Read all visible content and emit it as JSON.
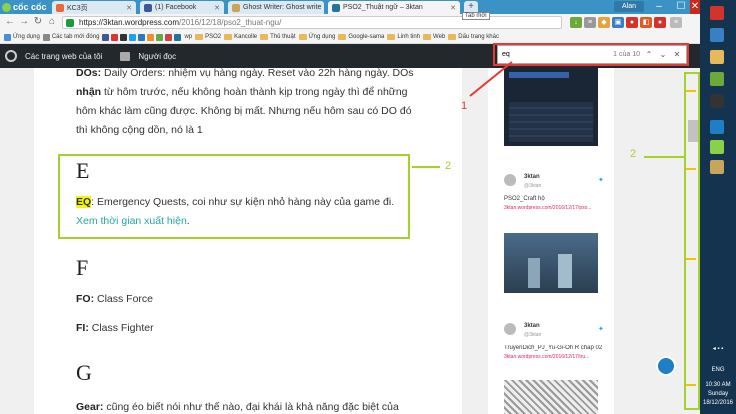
{
  "browser": {
    "logo": "cốc cốc",
    "tabs": [
      {
        "label": "KC3页"
      },
      {
        "label": "(1) Facebook"
      },
      {
        "label": "Ghost Writer: Ghost write"
      },
      {
        "label": "PSO2_Thuật ngữ – 3ktan"
      }
    ],
    "new_tab_tooltip": "Tab mới",
    "user": "Alan",
    "url_host": "https://3ktan.wordpress.com",
    "url_path": "/2016/12/18/pso2_thuat-ngu/"
  },
  "bookmarks": [
    {
      "label": "Ứng dụng",
      "type": "apps"
    },
    {
      "label": "Các tab mới đóng",
      "type": "item"
    },
    {
      "label": "wp",
      "type": "item"
    },
    {
      "label": "PSO2",
      "type": "folder"
    },
    {
      "label": "Kancolle",
      "type": "folder"
    },
    {
      "label": "Thủ thuật",
      "type": "folder"
    },
    {
      "label": "Ứng dụng",
      "type": "folder"
    },
    {
      "label": "Google-sama",
      "type": "folder"
    },
    {
      "label": "Linh tinh",
      "type": "folder"
    },
    {
      "label": "Web",
      "type": "folder"
    },
    {
      "label": "Dấu trang khác",
      "type": "folder"
    }
  ],
  "wpbar": {
    "sites": "Các trang web của tôi",
    "reader": "Người đọc"
  },
  "find": {
    "query": "eq",
    "count": "1 của 10"
  },
  "article": {
    "dos_term": "DOs:",
    "dos_text_1": " Daily Orders: nhiệm vụ hàng ngày. Reset vào 22h hàng ngày. DOs",
    "dos_bold": "nhận",
    "dos_text_2": " từ hôm trước, nếu không hoàn thành kịp trong ngày thì để những hôm khác làm cũng được. Không bị mất. Nhưng nếu hôm sau có DO đó thì không cộng dồn, nó là 1",
    "letter_e": "E",
    "eq_term": "EQ",
    "eq_text": ": Emergency Quests, coi như sự kiện nhỏ hàng này của game đi. ",
    "eq_link": "Xem thời gian xuất hiện",
    "eq_end": ".",
    "letter_f": "F",
    "fo_term": "FO:",
    "fo_text": " Class Force",
    "fi_term": "FI:",
    "fi_text": " Class Fighter",
    "letter_g": "G",
    "gear_term": "Gear:",
    "gear_text": " cũng éo biết nói như thế nào, đại khái là khả năng đặc biệt của"
  },
  "sidebar": {
    "posts": [
      {
        "author": "3ktan",
        "handle": "@3ktan",
        "title": "PSO2_Craft hộ",
        "link": "3ktan.wordpress.com/2016/12/17/pso..."
      },
      {
        "author": "3ktan",
        "handle": "@3ktan",
        "title": "TruyenDich_PJ_Yu-Gi-Oh R chap 02",
        "link": "3ktan.wordpress.com/2016/12/17/tru..."
      }
    ]
  },
  "annotations": {
    "label_1": "1",
    "label_2a": "2",
    "label_2b": "2",
    "colors": {
      "red": "#e53935",
      "green": "#a5d22a"
    }
  },
  "taskbar": {
    "lang": "ENG",
    "time": "10:30 AM",
    "day": "Sunday",
    "date": "18/12/2016"
  }
}
